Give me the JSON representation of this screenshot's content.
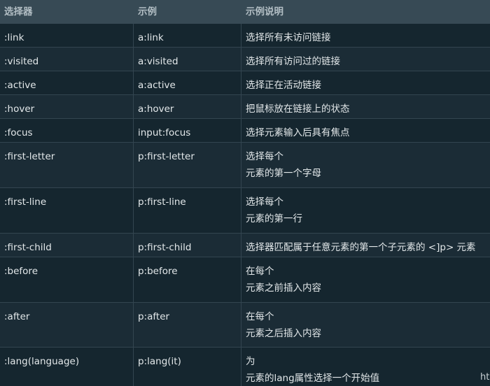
{
  "headers": [
    "选择器",
    "示例",
    "示例说明"
  ],
  "rows": [
    {
      "selector": ":link",
      "example": "a:link",
      "desc": [
        "选择所有未访问链接"
      ]
    },
    {
      "selector": ":visited",
      "example": "a:visited",
      "desc": [
        "选择所有访问过的链接"
      ]
    },
    {
      "selector": ":active",
      "example": "a:active",
      "desc": [
        "选择正在活动链接"
      ]
    },
    {
      "selector": ":hover",
      "example": "a:hover",
      "desc": [
        "把鼠标放在链接上的状态"
      ]
    },
    {
      "selector": ":focus",
      "example": "input:focus",
      "desc": [
        "选择元素输入后具有焦点"
      ]
    },
    {
      "selector": ":first-letter",
      "example": "p:first-letter",
      "desc": [
        "选择每个",
        "元素的第一个字母"
      ]
    },
    {
      "selector": ":first-line",
      "example": "p:first-line",
      "desc": [
        "选择每个",
        "元素的第一行"
      ]
    },
    {
      "selector": ":first-child",
      "example": "p:first-child",
      "desc": [
        "选择器匹配属于任意元素的第一个子元素的 <]p> 元素"
      ]
    },
    {
      "selector": ":before",
      "example": "p:before",
      "desc": [
        "在每个",
        "元素之前插入内容"
      ]
    },
    {
      "selector": ":after",
      "example": "p:after",
      "desc": [
        "在每个",
        "元素之后插入内容"
      ]
    },
    {
      "selector": ":lang(language)",
      "example": "p:lang(it)",
      "desc": [
        "为",
        "元素的lang属性选择一个开始值"
      ]
    }
  ],
  "watermark": "ht"
}
